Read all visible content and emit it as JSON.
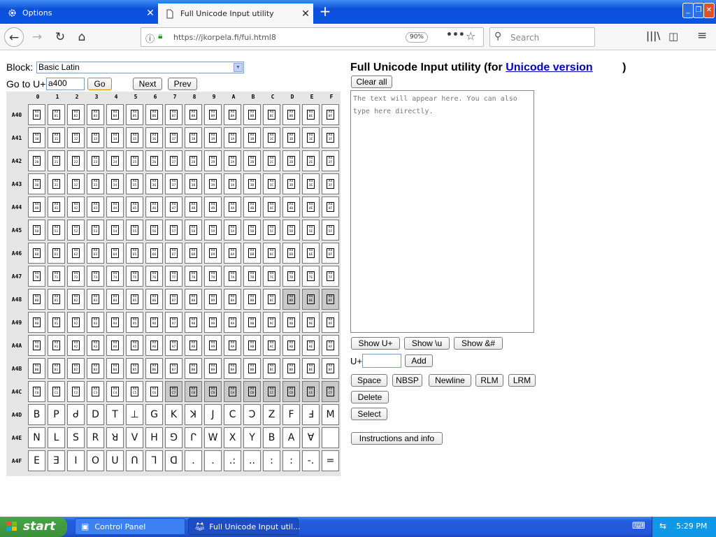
{
  "tabs": [
    {
      "label": "Options",
      "icon": "gear-icon"
    },
    {
      "label": "Full Unicode Input utility",
      "icon": "page-icon"
    }
  ],
  "window_controls": {
    "minimize": "_",
    "restore": "❐",
    "close": "✕"
  },
  "nav": {
    "url": "https://jkorpela.fi/fui.html8",
    "zoom": "90%",
    "search_placeholder": "Search"
  },
  "page": {
    "block_label": "Block:",
    "block_value": "Basic Latin",
    "goto_label": "Go to U+",
    "goto_value": "a400",
    "go_button": "Go",
    "next_button": "Next",
    "prev_button": "Prev",
    "title": "Full Unicode Input utility (for",
    "title_link": "Unicode version",
    "title_close": ")",
    "clear_all": "Clear all",
    "textarea_placeholder": "The text will appear here. You can also type here directly.",
    "show_u": "Show U+",
    "show_backslash_u": "Show \\u",
    "show_amp": "Show &#",
    "u_plus_label": "U+",
    "u_plus_value": "",
    "add_button": "Add",
    "space_button": "Space",
    "nbsp_button": "NBSP",
    "newline_button": "Newline",
    "rlm_button": "RLM",
    "lrm_button": "LRM",
    "delete_button": "Delete",
    "select_button": "Select",
    "instructions_button": "Instructions and info"
  },
  "grid": {
    "col_headers": [
      "0",
      "1",
      "2",
      "3",
      "4",
      "5",
      "6",
      "7",
      "8",
      "9",
      "A",
      "B",
      "C",
      "D",
      "E",
      "F"
    ],
    "row_headers": [
      "A40",
      "A41",
      "A42",
      "A43",
      "A44",
      "A45",
      "A46",
      "A47",
      "A48",
      "A49",
      "A4A",
      "A4B",
      "A4C",
      "A4D",
      "A4E",
      "A4F"
    ],
    "hex_rows": 13,
    "shaded_cells": [
      "A48D",
      "A48E",
      "A48F",
      "A4C7",
      "A4C8",
      "A4C9",
      "A4CA",
      "A4CB",
      "A4CC",
      "A4CD",
      "A4CE",
      "A4CF"
    ],
    "glyph_rows": [
      [
        "B",
        "P",
        "ᑯ",
        "D",
        "T",
        "⊥",
        "G",
        "K",
        "ꓘ",
        "J",
        "C",
        "Ɔ",
        "Z",
        "F",
        "Ⅎ",
        "M"
      ],
      [
        "N",
        "L",
        "S",
        "R",
        "ꓤ",
        "V",
        "H",
        "⅁",
        "ᒋ",
        "W",
        "X",
        "Y",
        "B",
        "A",
        "Ɐ",
        ""
      ],
      [
        "E",
        "Ǝ",
        "I",
        "O",
        "U",
        "Ո",
        "Ꞁ",
        "ᗡ",
        ".",
        ".",
        ".:",
        "..",
        ":",
        ":",
        "-.",
        "="
      ]
    ]
  },
  "taskbar": {
    "start": "start",
    "tasks": [
      "Control Panel",
      "Full Unicode Input util..."
    ],
    "clock": "5:29 PM"
  }
}
